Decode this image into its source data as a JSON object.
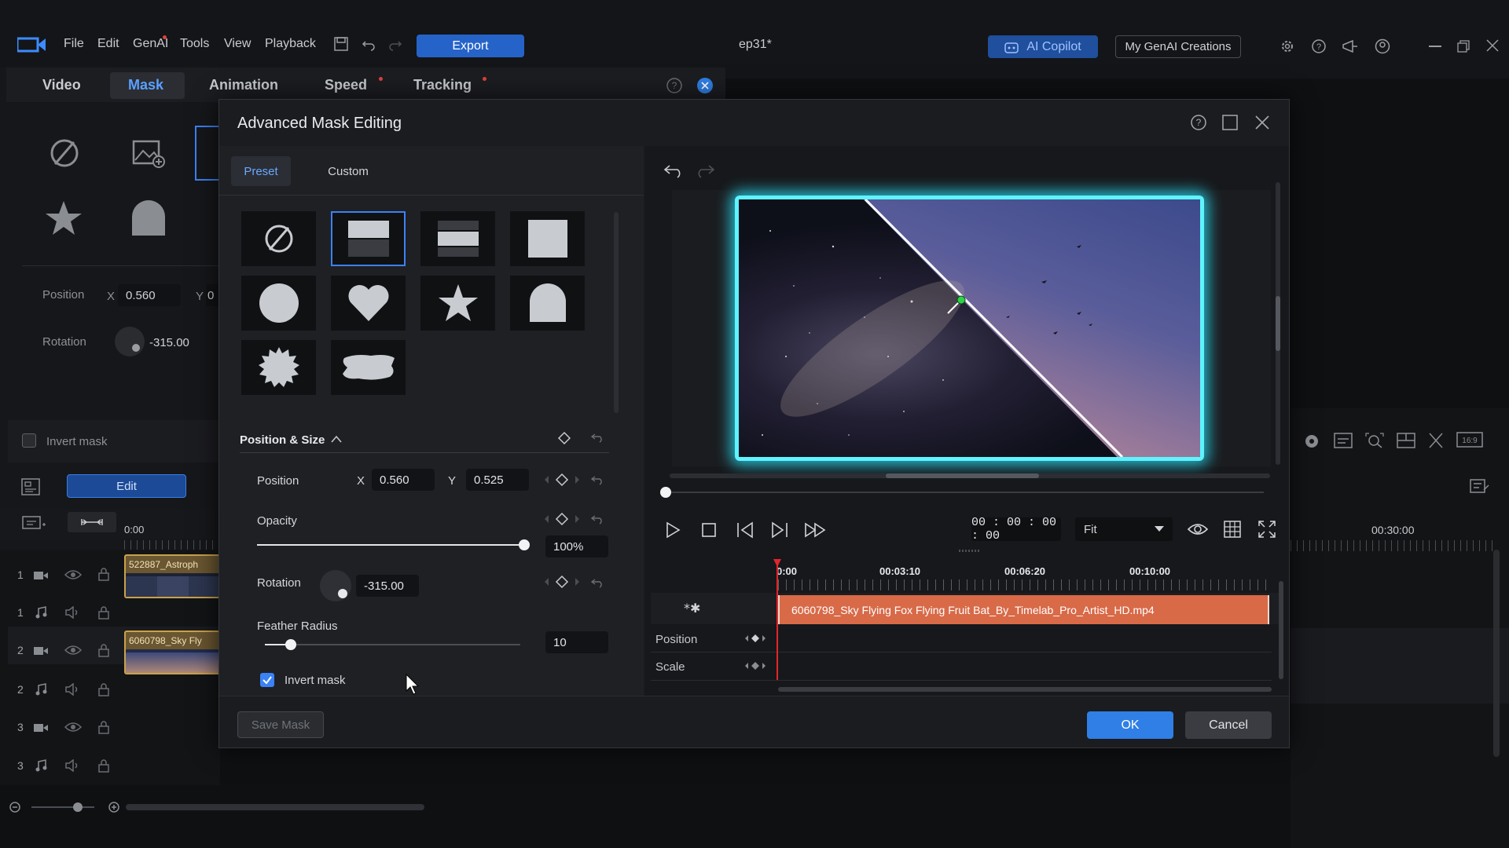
{
  "titlebar": {
    "menu": [
      "File",
      "Edit",
      "GenAI",
      "Tools",
      "View",
      "Playback"
    ],
    "export_label": "Export",
    "project_name": "ep31*",
    "ai_copilot_label": "AI Copilot",
    "my_genai_label": "My GenAI Creations"
  },
  "left_panel": {
    "tabs": [
      "Video",
      "Mask",
      "Animation",
      "Speed",
      "Tracking"
    ],
    "position_label": "Position",
    "x_label": "X",
    "x_value": "0.560",
    "y_label": "Y",
    "y_value": "0",
    "rotation_label": "Rotation",
    "rotation_value": "-315.00",
    "invert_mask_label": "Invert mask",
    "edit_label": "Edit",
    "timecode_start": "0:00"
  },
  "timeline_left": {
    "tracks": [
      {
        "num": "1",
        "type": "video",
        "clip": "522887_Astroph"
      },
      {
        "num": "1",
        "type": "audio",
        "clip": ""
      },
      {
        "num": "2",
        "type": "video",
        "clip": "6060798_Sky Fly"
      },
      {
        "num": "2",
        "type": "audio",
        "clip": ""
      },
      {
        "num": "3",
        "type": "video",
        "clip": ""
      },
      {
        "num": "3",
        "type": "audio",
        "clip": ""
      }
    ],
    "right_ruler_time": "00:30:00"
  },
  "dialog": {
    "title": "Advanced Mask Editing",
    "tabs": {
      "preset": "Preset",
      "custom": "Custom"
    },
    "section_position_size": "Position & Size",
    "position_label": "Position",
    "x_label": "X",
    "x_value": "0.560",
    "y_label": "Y",
    "y_value": "0.525",
    "opacity_label": "Opacity",
    "opacity_value": "100%",
    "opacity_level": 1.0,
    "rotation_label": "Rotation",
    "rotation_value": "-315.00",
    "feather_label": "Feather Radius",
    "feather_value": "10",
    "feather_level": 0.1,
    "invert_mask_label": "Invert mask",
    "invert_mask_checked": true,
    "save_mask_label": "Save Mask",
    "ok_label": "OK",
    "cancel_label": "Cancel",
    "preview": {
      "timecode": "00 : 00 : 00 : 00",
      "fit_label": "Fit"
    },
    "timeline": {
      "ruler": [
        "0:00",
        "00:03:10",
        "00:06:20",
        "00:10:00"
      ],
      "clip_name": "6060798_Sky Flying Fox Flying Fruit Bat_By_Timelab_Pro_Artist_HD.mp4",
      "rows": [
        "Position",
        "Scale"
      ]
    }
  },
  "colors": {
    "accent": "#2f7fe6",
    "glow": "#5ff3ff",
    "clip": "#d86a48"
  }
}
